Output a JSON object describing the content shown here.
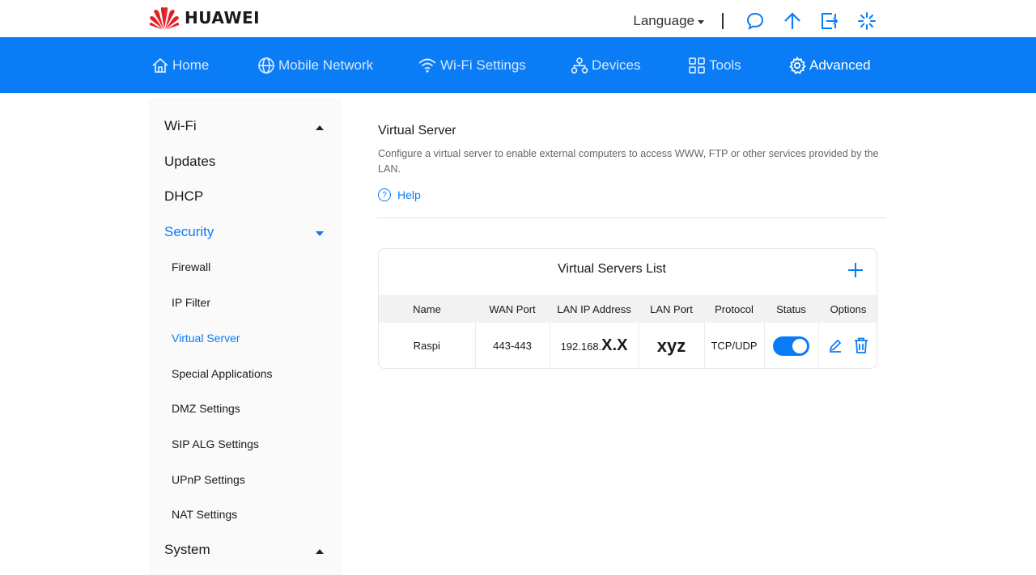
{
  "brand": {
    "name": "HUAWEI",
    "accent_color": "#0a7cf5"
  },
  "topbar": {
    "language_label": "Language",
    "icons": [
      "chat-icon",
      "upload-arrow-icon",
      "logout-icon",
      "loading-icon"
    ]
  },
  "nav": {
    "items": [
      {
        "label": "Home",
        "icon": "home-icon"
      },
      {
        "label": "Mobile Network",
        "icon": "globe-icon"
      },
      {
        "label": "Wi-Fi Settings",
        "icon": "wifi-icon"
      },
      {
        "label": "Devices",
        "icon": "devices-icon"
      },
      {
        "label": "Tools",
        "icon": "tools-icon"
      },
      {
        "label": "Advanced",
        "icon": "gear-icon"
      }
    ],
    "active": "Advanced"
  },
  "sidebar": {
    "items": [
      {
        "label": "Wi-Fi"
      },
      {
        "label": "Updates"
      },
      {
        "label": "DHCP"
      },
      {
        "label": "Security"
      },
      {
        "label": "System"
      }
    ],
    "security_subitems": [
      {
        "label": "Firewall"
      },
      {
        "label": "IP Filter"
      },
      {
        "label": "Virtual Server"
      },
      {
        "label": "Special Applications"
      },
      {
        "label": "DMZ Settings"
      },
      {
        "label": "SIP ALG Settings"
      },
      {
        "label": "UPnP Settings"
      },
      {
        "label": "NAT Settings"
      }
    ],
    "active_subitem": "Virtual Server"
  },
  "page": {
    "title": "Virtual Server",
    "description": "Configure a virtual server to enable external computers to access WWW, FTP or other services provided by the LAN.",
    "help_label": "Help"
  },
  "list": {
    "title": "Virtual Servers List",
    "columns": [
      "Name",
      "WAN Port",
      "LAN IP Address",
      "LAN Port",
      "Protocol",
      "Status",
      "Options"
    ],
    "rows": [
      {
        "name": "Raspi",
        "wan_port": "443-443",
        "lan_ip_prefix": "192.168.",
        "lan_ip_redacted": "X.X",
        "lan_port": "xyz",
        "protocol": "TCP/UDP",
        "status_enabled": true
      }
    ]
  }
}
